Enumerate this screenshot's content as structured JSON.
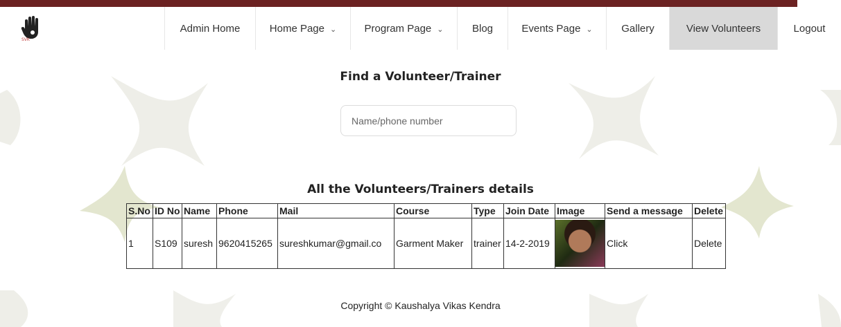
{
  "nav": {
    "logo_icon": "hand-logo-icon",
    "items": [
      {
        "label": "Admin Home",
        "dropdown": false,
        "active": false
      },
      {
        "label": "Home Page",
        "dropdown": true,
        "active": false
      },
      {
        "label": "Program Page",
        "dropdown": true,
        "active": false
      },
      {
        "label": "Blog",
        "dropdown": false,
        "active": false
      },
      {
        "label": "Events Page",
        "dropdown": true,
        "active": false
      },
      {
        "label": "Gallery",
        "dropdown": false,
        "active": false
      },
      {
        "label": "View Volunteers",
        "dropdown": false,
        "active": true
      },
      {
        "label": "Logout",
        "dropdown": false,
        "active": false
      }
    ],
    "chevron": "⌄"
  },
  "search": {
    "title": "Find a Volunteer/Trainer",
    "placeholder": "Name/phone number",
    "value": ""
  },
  "table": {
    "title": "All the Volunteers/Trainers details",
    "headers": [
      "S.No",
      "ID No",
      "Name",
      "Phone",
      "Mail",
      "Course",
      "Type",
      "Join Date",
      "Image",
      "Send a message",
      "Delete"
    ],
    "rows": [
      {
        "sno": "1",
        "id": "S109",
        "name": "suresh",
        "phone": "9620415265",
        "mail": "sureshkumar@gmail.co",
        "course": "Garment Maker",
        "type": "trainer",
        "join_date": "14-2-2019",
        "image": "volunteer-photo",
        "message": "Click",
        "delete": "Delete"
      }
    ]
  },
  "footer": {
    "text": "Copyright © Kaushalya Vikas Kendra"
  },
  "colors": {
    "top_bar": "#6b2222",
    "active_nav": "#d9d9d9",
    "decor_star": "#e9eadf"
  }
}
